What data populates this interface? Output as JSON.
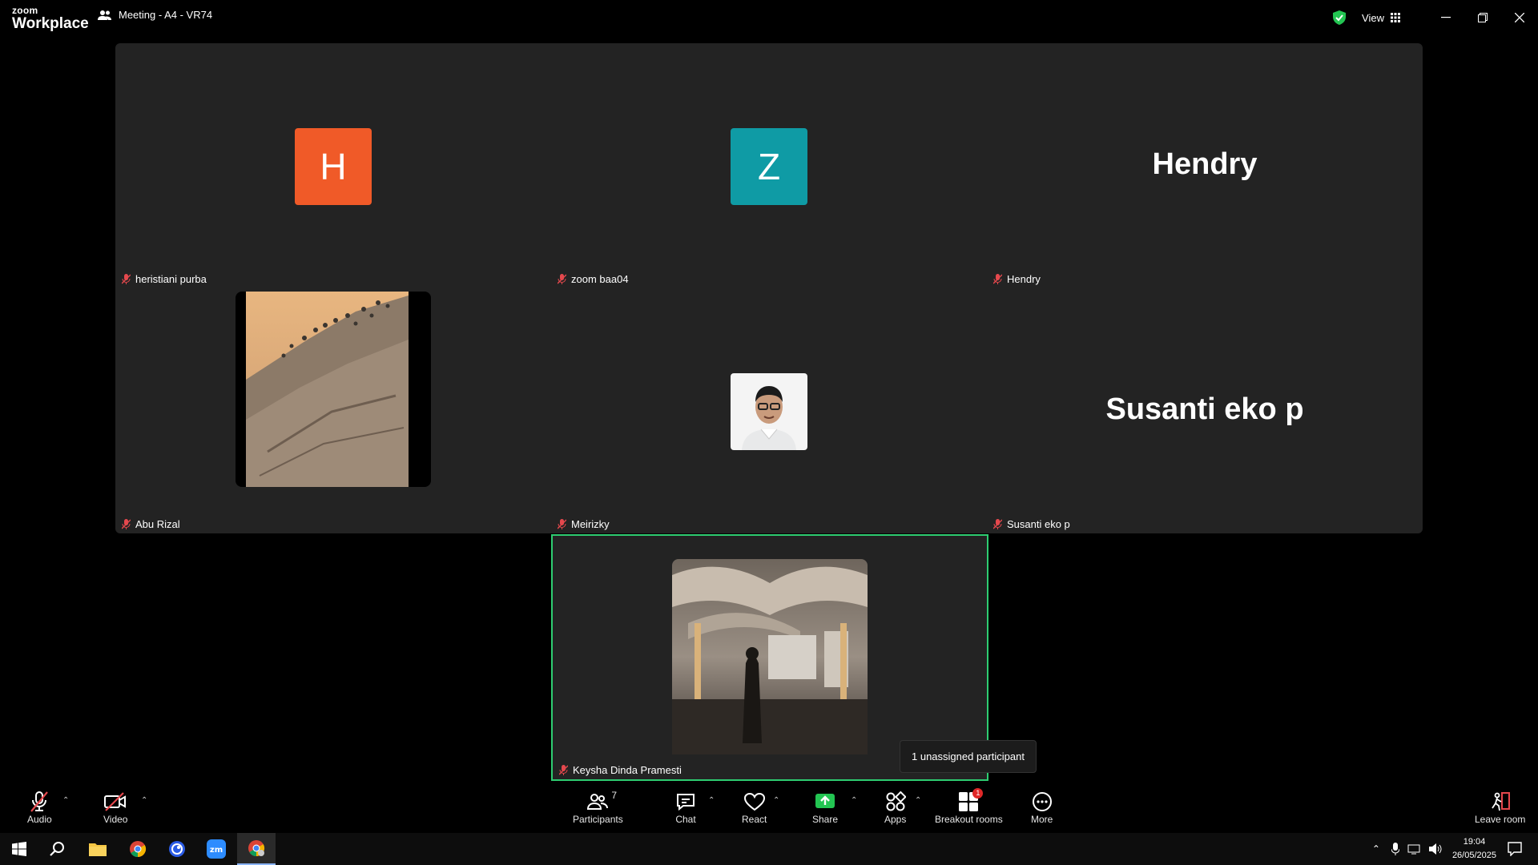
{
  "app": {
    "brand_line1": "zoom",
    "brand_line2": "Workplace",
    "meeting_title": "Meeting - A4 - VR74",
    "view_label": "View"
  },
  "colors": {
    "accent_green": "#2ecc71",
    "avatar_h": "#f05a28",
    "avatar_z": "#0f9ba5",
    "muted_red": "#e5484d",
    "badge_red": "#e02828"
  },
  "tiles": [
    {
      "name": "heristiani purba",
      "avatar_letter": "H",
      "muted": true
    },
    {
      "name": "zoom baa04",
      "avatar_letter": "Z",
      "muted": true
    },
    {
      "name": "Hendry",
      "display_text": "Hendry",
      "muted": true
    },
    {
      "name": "Abu Rizal",
      "avatar": "rocky-hill-birds-photo",
      "muted": true
    },
    {
      "name": "Meirizky",
      "avatar": "man-with-glasses-photo",
      "muted": true
    },
    {
      "name": "Susanti eko p",
      "display_text": "Susanti eko p",
      "muted": true
    }
  ],
  "active_speaker": {
    "name": "Keysha Dinda Pramesti",
    "avatar": "mosque-umbrellas-photo",
    "muted": true
  },
  "tooltip": {
    "text": "1 unassigned participant"
  },
  "toolbar": {
    "audio": "Audio",
    "video": "Video",
    "participants": "Participants",
    "participants_count": "7",
    "chat": "Chat",
    "react": "React",
    "share": "Share",
    "apps": "Apps",
    "breakout": "Breakout rooms",
    "breakout_badge": "1",
    "more": "More",
    "leave": "Leave room"
  },
  "taskbar": {
    "time": "19:04",
    "date": "26/05/2025"
  }
}
